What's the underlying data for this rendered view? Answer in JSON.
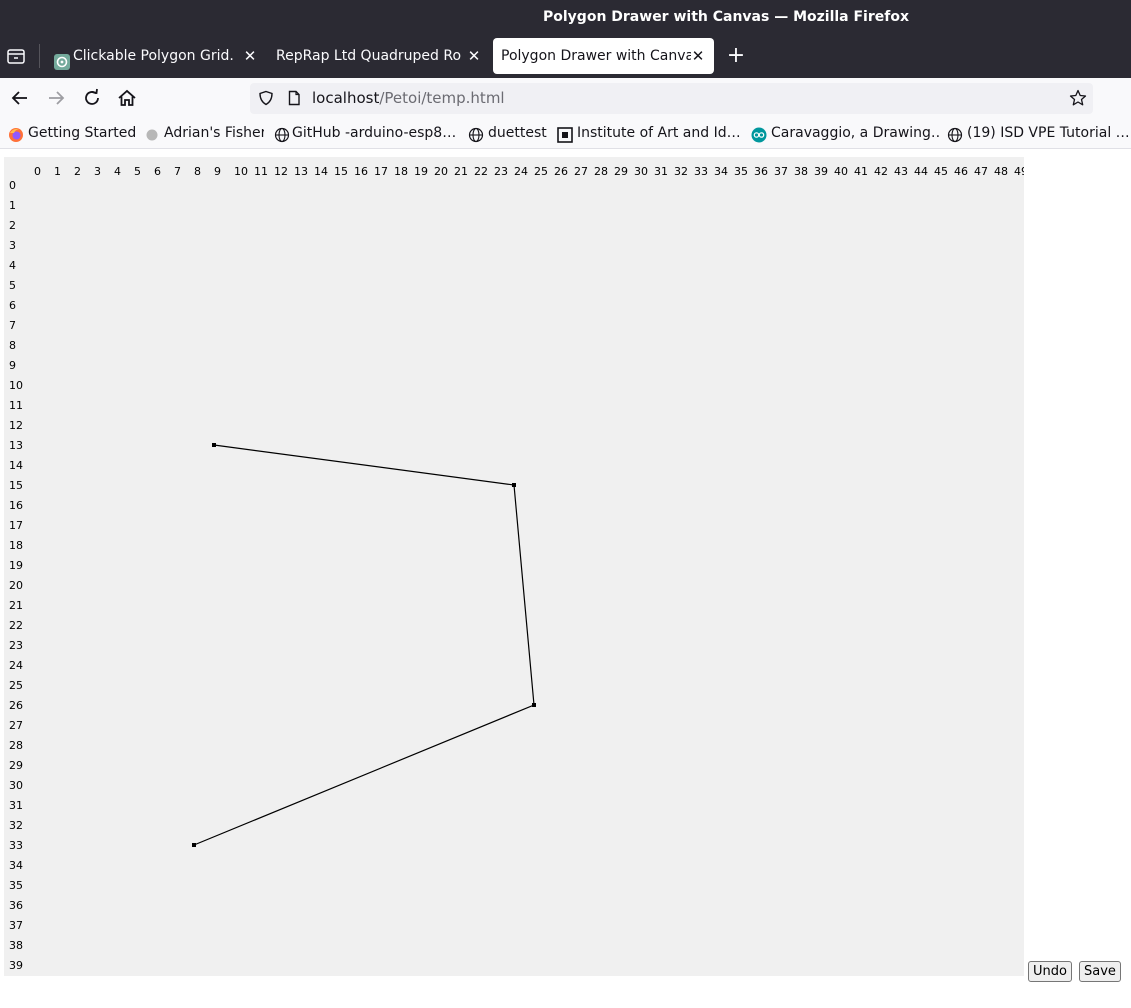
{
  "window": {
    "title": "Polygon Drawer with Canvas — Mozilla Firefox"
  },
  "tabs": [
    {
      "label": "Clickable Polygon Grid.",
      "active": false,
      "icon": "chatgpt-icon"
    },
    {
      "label": "RepRap Ltd Quadruped Rob",
      "active": false,
      "icon": "none"
    },
    {
      "label": "Polygon Drawer with Canvas",
      "active": true,
      "icon": "none"
    }
  ],
  "navigation": {
    "url_host": "localhost",
    "url_path": "/Petoi/temp.html"
  },
  "bookmarks": [
    {
      "label": "Getting Started",
      "icon": "firefox-icon"
    },
    {
      "label": "Adrian's Fisher",
      "icon": "grey-circle-icon"
    },
    {
      "label": "GitHub -arduino-esp8…",
      "icon": "globe-icon"
    },
    {
      "label": "duettest",
      "icon": "globe-icon"
    },
    {
      "label": "Institute of Art and Id…",
      "icon": "iai-icon"
    },
    {
      "label": "Caravaggio, a Drawing…",
      "icon": "arduino-icon"
    },
    {
      "label": "(19) ISD VPE Tutorial …",
      "icon": "globe-icon"
    }
  ],
  "grid": {
    "columns": 50,
    "rows": 40,
    "points": [
      [
        9,
        13
      ],
      [
        24,
        15
      ],
      [
        25,
        26
      ],
      [
        8,
        33
      ]
    ]
  },
  "buttons": {
    "undo": "Undo",
    "save": "Save"
  },
  "colors": {
    "titlebar": "#2b2a33",
    "canvas_bg": "#f0f0f0",
    "line": "#000000"
  }
}
